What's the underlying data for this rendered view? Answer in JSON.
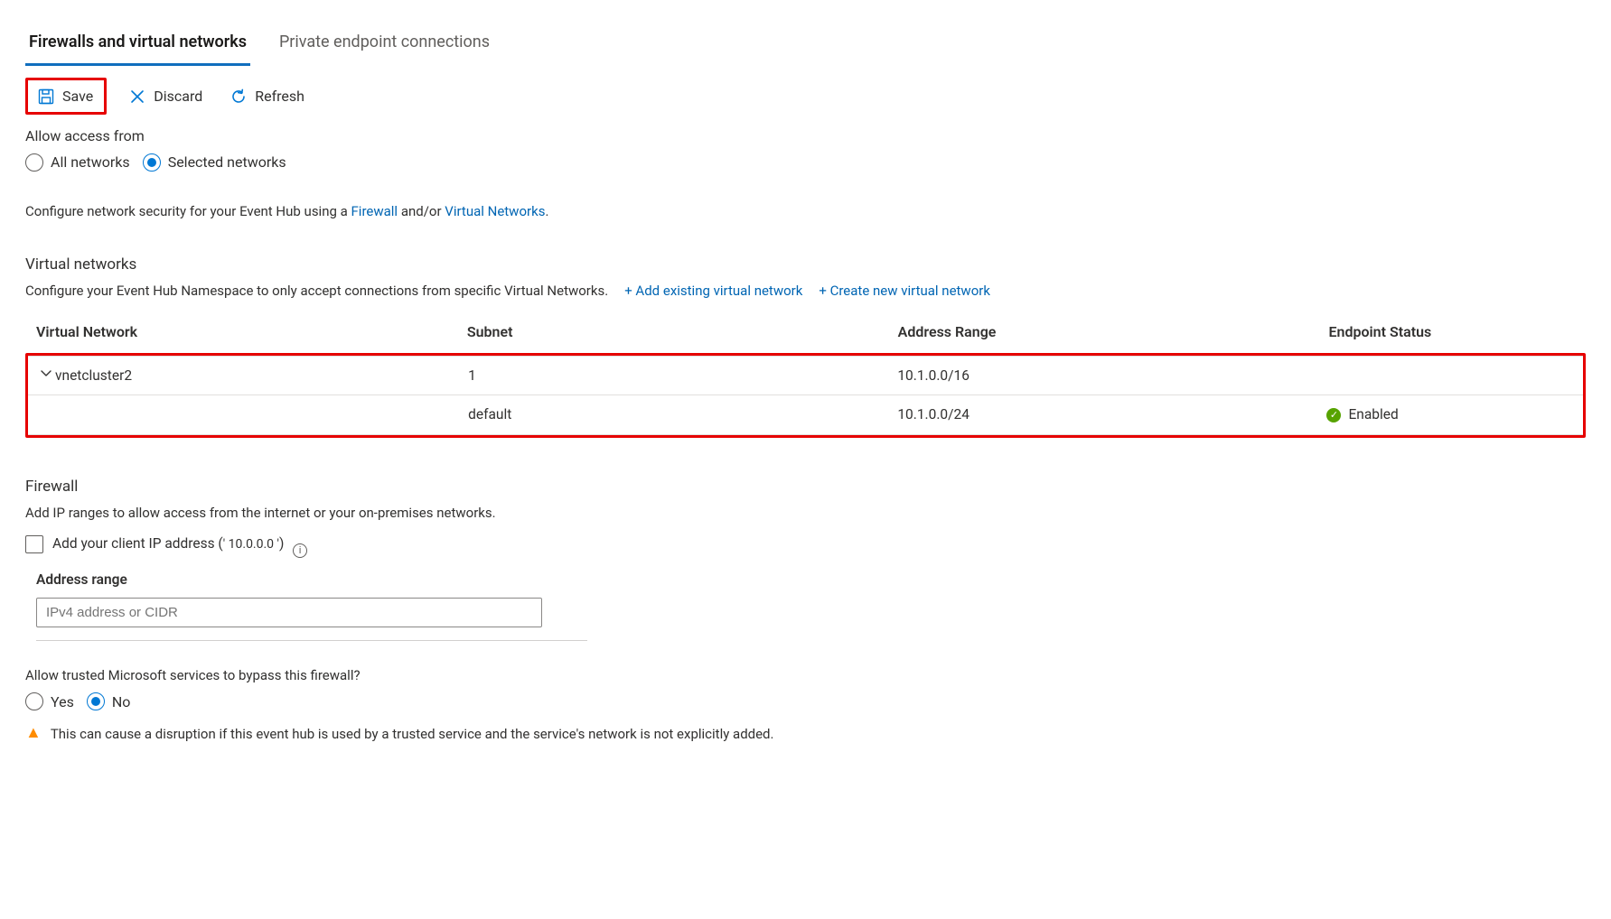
{
  "tabs": {
    "firewalls": "Firewalls and virtual networks",
    "private_ep": "Private endpoint connections"
  },
  "commands": {
    "save": "Save",
    "discard": "Discard",
    "refresh": "Refresh"
  },
  "access": {
    "label": "Allow access from",
    "all": "All networks",
    "selected": "Selected networks"
  },
  "intro": {
    "pre": "Configure network security for your Event Hub using a ",
    "fw_link": "Firewall",
    "mid": " and/or ",
    "vn_link": "Virtual Networks",
    "post": "."
  },
  "vnets": {
    "title": "Virtual networks",
    "desc": "Configure your Event Hub Namespace to only accept connections from specific Virtual Networks.",
    "add_existing": "+ Add existing virtual network",
    "create_new": "+ Create new virtual network",
    "headers": {
      "vnet": "Virtual Network",
      "subnet": "Subnet",
      "range": "Address Range",
      "status": "Endpoint Status"
    },
    "row": {
      "name": "vnetcluster2",
      "subnet_count": "1",
      "range": "10.1.0.0/16"
    },
    "subrow": {
      "subnet": "default",
      "range": "10.1.0.0/24",
      "status": "Enabled"
    }
  },
  "firewall": {
    "title": "Firewall",
    "desc": "Add IP ranges to allow access from the internet or your on-premises networks.",
    "add_client_pre": "Add your client IP address (",
    "client_ip": "' 10.0.0.0  '",
    "add_client_post": ")",
    "addr_col": "Address range",
    "placeholder": "IPv4 address or CIDR"
  },
  "bypass": {
    "question": "Allow trusted Microsoft services to bypass this firewall?",
    "yes": "Yes",
    "no": "No",
    "warning": "This can cause a disruption if this event hub is used by a trusted service and the service's network is not explicitly added."
  }
}
